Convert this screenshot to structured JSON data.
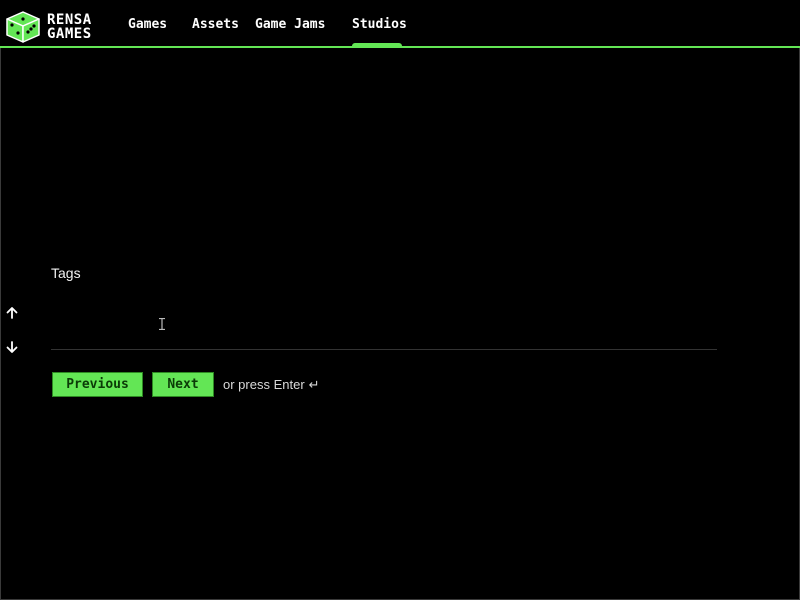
{
  "colors": {
    "accent": "#63e655",
    "background": "#000000",
    "text": "#ffffff"
  },
  "brand": {
    "line1": "RENSA",
    "line2": "GAMES",
    "icon": "dice-cube-logo-icon"
  },
  "nav": {
    "items": [
      {
        "label": "Games",
        "active": false
      },
      {
        "label": "Assets",
        "active": false
      },
      {
        "label": "Game Jams",
        "active": false
      },
      {
        "label": "Studios",
        "active": true
      }
    ]
  },
  "form": {
    "label": "Tags",
    "value": "",
    "up_icon": "arrow-up-icon",
    "down_icon": "arrow-down-icon"
  },
  "actions": {
    "previous_label": "Previous",
    "next_label": "Next",
    "hint": "or press Enter",
    "hint_icon": "↵"
  }
}
